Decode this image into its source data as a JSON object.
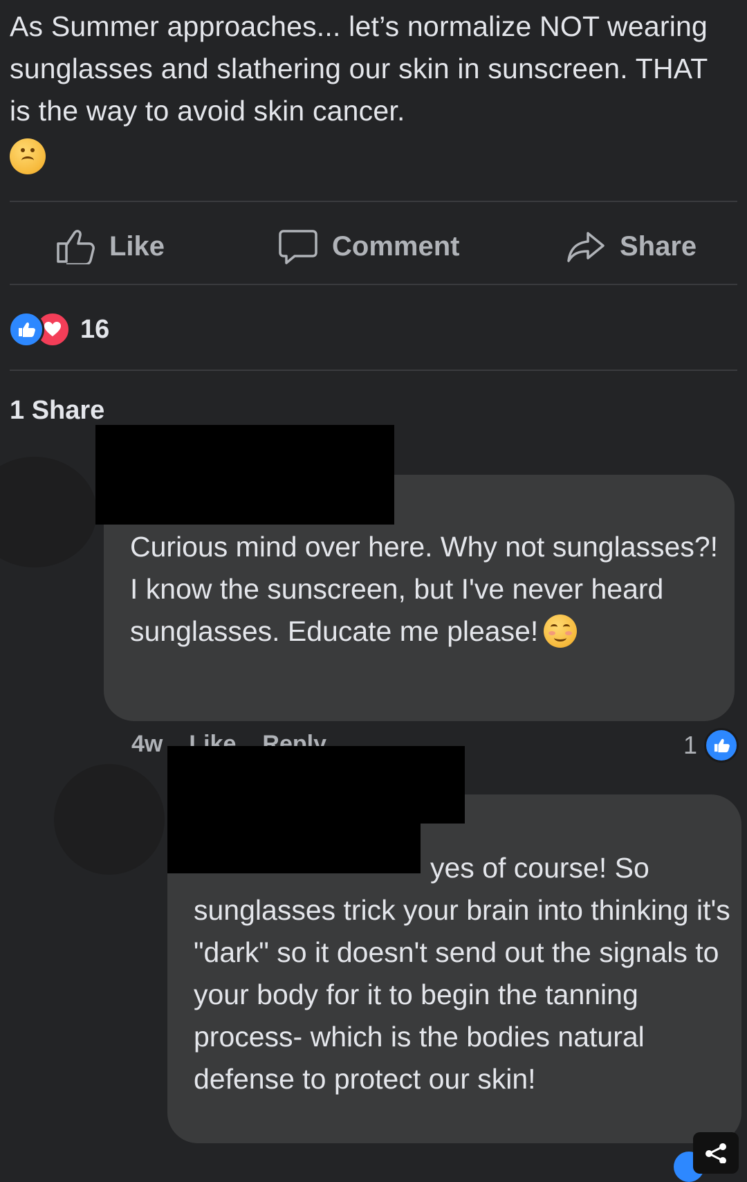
{
  "post": {
    "text": "As Summer approaches... let’s normalize NOT wearing sunglasses and slathering our skin in sunscreen. THAT is the way to avoid skin cancer.",
    "emoji_icon": "upside-down-face-icon"
  },
  "actions": {
    "like_label": "Like",
    "comment_label": "Comment",
    "share_label": "Share"
  },
  "reactions": {
    "types": [
      "like-icon",
      "love-icon"
    ],
    "count": "16"
  },
  "shares_label": "1 Share",
  "comments": [
    {
      "author": "",
      "text": "Curious mind over here. Why not sunglasses?! I know the sunscreen, but I've never heard sunglasses. Educate me please!",
      "emoji_icon": "smiling-face-icon",
      "time": "4w",
      "like_label": "Like",
      "reply_label": "Reply",
      "like_count": "1"
    },
    {
      "author": "",
      "text": "yes of course! So sunglasses trick your brain into thinking it's \"dark\" so it doesn't send out the signals to your body for it to begin the tanning process- which is the bodies natural defense to protect our skin!"
    }
  ],
  "colors": {
    "background": "#232426",
    "bubble": "#3a3b3c",
    "text": "#e4e6eb",
    "muted": "#b0b3b8",
    "like_blue": "#2d88ff",
    "love_red": "#f33e58"
  }
}
